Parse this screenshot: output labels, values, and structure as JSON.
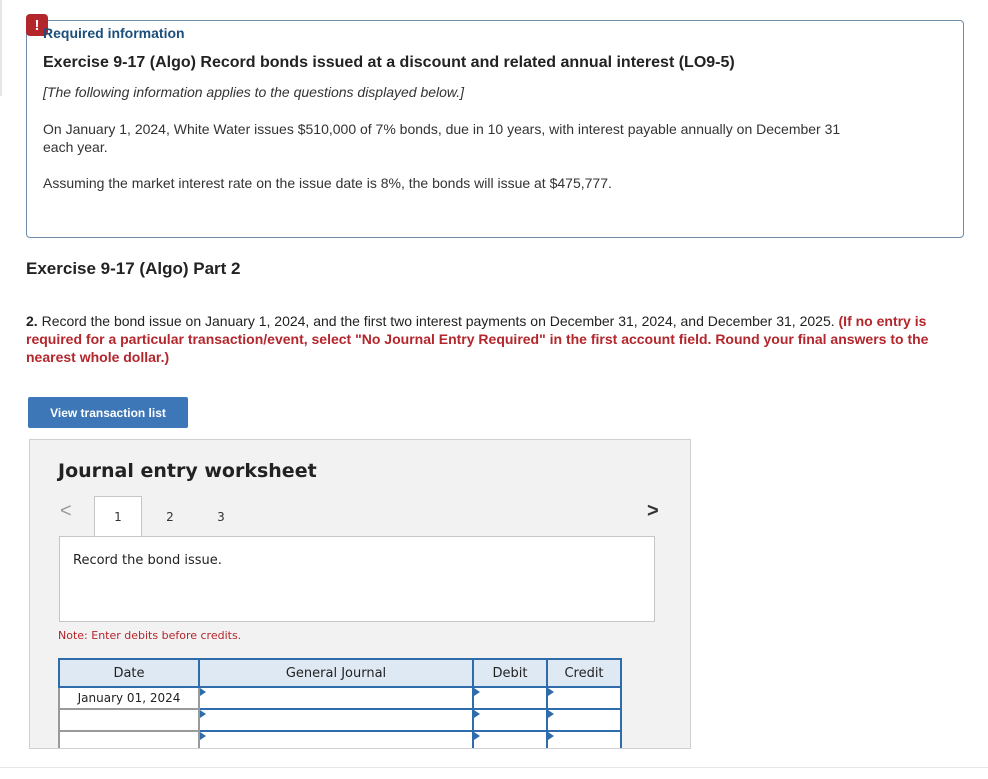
{
  "badge": "!",
  "required": {
    "title": "Required information",
    "heading": "Exercise 9-17 (Algo) Record bonds issued at a discount and related annual interest (LO9-5)",
    "note": "[The following information applies to the questions displayed below.]",
    "para1": "On January 1, 2024, White Water issues $510,000 of 7% bonds, due in 10 years, with interest payable annually on December 31 each year.",
    "para2": "Assuming the market interest rate on the issue date is 8%, the bonds will issue at $475,777."
  },
  "part": {
    "title": "Exercise 9-17 (Algo) Part 2",
    "question_num": "2.",
    "question_text": "Record the bond issue on January 1, 2024, and the first two interest payments on December 31, 2024, and December 31, 2025.",
    "question_instruction": "(If no entry is required for a particular transaction/event, select \"No Journal Entry Required\" in the first account field. Round your final answers to the nearest whole dollar.)"
  },
  "button_view": "View transaction list",
  "worksheet": {
    "title": "Journal entry worksheet",
    "prev_icon": "<",
    "next_icon": ">",
    "tabs": [
      "1",
      "2",
      "3"
    ],
    "active_tab": "1",
    "panel_text": "Record the bond issue.",
    "note": "Note: Enter debits before credits.",
    "columns": [
      "Date",
      "General Journal",
      "Debit",
      "Credit"
    ],
    "rows": [
      {
        "date": "January 01, 2024",
        "account": "",
        "debit": "",
        "credit": ""
      },
      {
        "date": "",
        "account": "",
        "debit": "",
        "credit": ""
      },
      {
        "date": "",
        "account": "",
        "debit": "",
        "credit": ""
      }
    ]
  },
  "colors": {
    "accent": "#3d77b7",
    "alert": "#b3262c",
    "table_border": "#2f6cab"
  }
}
